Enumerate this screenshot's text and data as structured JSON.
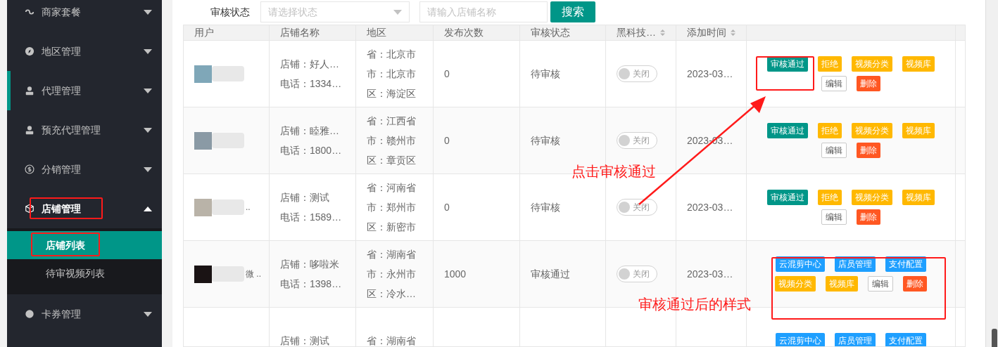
{
  "sidebar": {
    "items": [
      {
        "label": "商家套餐",
        "expanded": false,
        "selected": false
      },
      {
        "label": "地区管理",
        "expanded": false,
        "selected": false
      },
      {
        "label": "代理管理",
        "expanded": false,
        "selected": true
      },
      {
        "label": "预充代理管理",
        "expanded": false,
        "selected": false
      },
      {
        "label": "分销管理",
        "expanded": false,
        "selected": false
      },
      {
        "label": "店铺管理",
        "expanded": true,
        "selected": false,
        "children": [
          {
            "label": "店铺列表",
            "selected": true
          },
          {
            "label": "待审视频列表",
            "selected": false
          }
        ]
      },
      {
        "label": "卡券管理",
        "expanded": false,
        "selected": false
      }
    ]
  },
  "filters": {
    "status_label": "审核状态",
    "status_placeholder": "请选择状态",
    "name_placeholder": "请输入店铺名称",
    "search_button": "搜索"
  },
  "table": {
    "columns": [
      {
        "label": "用户"
      },
      {
        "label": "店铺名称"
      },
      {
        "label": "地区"
      },
      {
        "label": "发布次数"
      },
      {
        "label": "审核状态"
      },
      {
        "label": "黑科技…",
        "sortable": true
      },
      {
        "label": "添加时间",
        "sortable": true
      }
    ],
    "rows": [
      {
        "shop": "店铺：好人…",
        "phone": "电话：1334…",
        "region": [
          "省：北京市",
          "市：北京市",
          "区：海淀区"
        ],
        "count": "0",
        "status": "待审核",
        "switch": {
          "label": "关闭",
          "on": false
        },
        "time": "2023-03…",
        "actions": [
          {
            "label": "审核通过",
            "kind": "approve"
          },
          {
            "label": "拒绝",
            "kind": "warn"
          },
          {
            "label": "视频分类",
            "kind": "warn"
          },
          {
            "label": "视频库",
            "kind": "warn"
          },
          {
            "label": "编辑",
            "kind": "plain"
          },
          {
            "label": "删除",
            "kind": "danger"
          }
        ]
      },
      {
        "shop": "店铺：睦雅…",
        "phone": "电话：1800…",
        "region": [
          "省：江西省",
          "市：赣州市",
          "区：章贡区"
        ],
        "count": "0",
        "status": "待审核",
        "switch": {
          "label": "关闭",
          "on": false
        },
        "time": "2023-03…",
        "actions": [
          {
            "label": "审核通过",
            "kind": "approve"
          },
          {
            "label": "拒绝",
            "kind": "warn"
          },
          {
            "label": "视频分类",
            "kind": "warn"
          },
          {
            "label": "视频库",
            "kind": "warn"
          },
          {
            "label": "编辑",
            "kind": "plain"
          },
          {
            "label": "删除",
            "kind": "danger"
          }
        ]
      },
      {
        "user": "..",
        "shop": "店铺：测试",
        "phone": "电话：1589…",
        "region": [
          "省：河南省",
          "市：郑州市",
          "区：新密市"
        ],
        "count": "0",
        "status": "待审核",
        "switch": {
          "label": "关闭",
          "on": false
        },
        "time": "2023-03…",
        "actions": [
          {
            "label": "审核通过",
            "kind": "approve"
          },
          {
            "label": "拒绝",
            "kind": "warn"
          },
          {
            "label": "视频分类",
            "kind": "warn"
          },
          {
            "label": "视频库",
            "kind": "warn"
          },
          {
            "label": "编辑",
            "kind": "plain"
          },
          {
            "label": "删除",
            "kind": "danger"
          }
        ]
      },
      {
        "user": "微 ..",
        "shop": "店铺：哆啦米",
        "phone": "电话：1398…",
        "region": [
          "省：湖南省",
          "市：永州市",
          "区：冷水…"
        ],
        "count": "1000",
        "status": "审核通过",
        "switch": {
          "label": "关闭",
          "on": false
        },
        "time": "2023-03…",
        "actions": [
          {
            "label": "云混剪中心",
            "kind": "info"
          },
          {
            "label": "店员管理",
            "kind": "info"
          },
          {
            "label": "支付配置",
            "kind": "info"
          },
          {
            "label": "视频分类",
            "kind": "warn"
          },
          {
            "label": "视频库",
            "kind": "warn"
          },
          {
            "label": "编辑",
            "kind": "plain"
          },
          {
            "label": "删除",
            "kind": "danger"
          }
        ]
      },
      {
        "shop": "店铺：测试",
        "region": [
          "省：湖南省"
        ],
        "actions": [
          {
            "label": "云混剪中心",
            "kind": "info"
          },
          {
            "label": "店员管理",
            "kind": "info"
          },
          {
            "label": "支付配置",
            "kind": "info"
          }
        ]
      }
    ]
  },
  "annotations": [
    {
      "text": "点击审核通过"
    },
    {
      "text": "审核通过后的样式"
    }
  ]
}
